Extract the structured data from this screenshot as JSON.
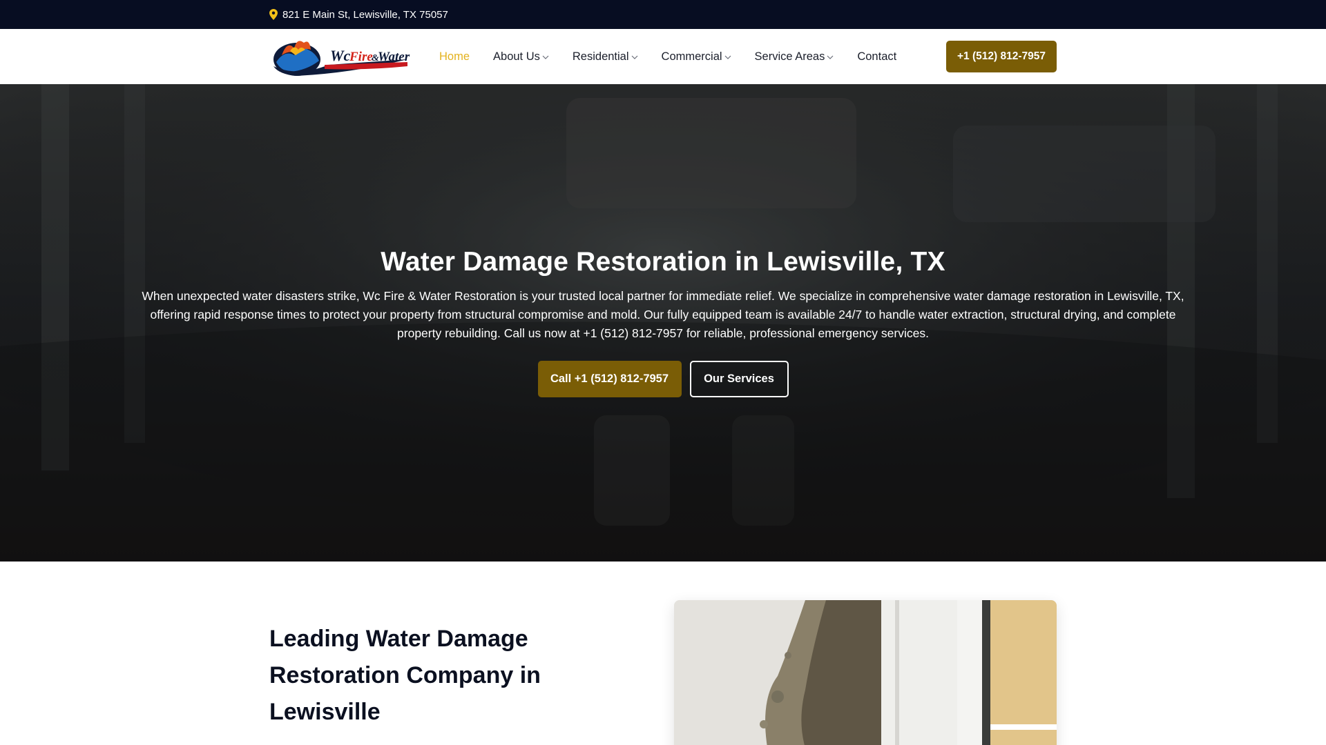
{
  "topbar": {
    "address": "821 E Main St, Lewisville, TX 75057",
    "icon": "map-pin-icon",
    "icon_color": "#f2c019"
  },
  "header": {
    "logo_text_wc": "Wc",
    "logo_text_fire": "Fire",
    "logo_text_and": "&",
    "logo_text_water": "Water",
    "nav": [
      {
        "label": "Home",
        "active": true
      },
      {
        "label": "About Us",
        "dropdown": true
      },
      {
        "label": "Residential",
        "dropdown": true
      },
      {
        "label": "Commercial",
        "dropdown": true
      },
      {
        "label": "Service Areas",
        "dropdown": true
      },
      {
        "label": "Contact"
      }
    ],
    "phone_button": "+1 (512) 812-7957"
  },
  "hero": {
    "title": "Water Damage Restoration in Lewisville, TX",
    "text": "When unexpected water disasters strike, Wc Fire & Water Restoration is your trusted local partner for immediate relief. We specialize in comprehensive water damage restoration in Lewisville, TX, offering rapid response times to protect your property from structural compromise and mold. Our fully equipped team is available 24/7 to handle water extraction, structural drying, and complete property rebuilding. Call us now at +1 (512) 812-7957 for reliable, professional emergency services.",
    "call_button": "Call +1 (512) 812-7957",
    "services_button": "Our Services"
  },
  "intro": {
    "heading": "Leading Water Damage Restoration Company in Lewisville"
  },
  "colors": {
    "topbar_bg": "#070d22",
    "accent_gold": "#7a5d06",
    "nav_active": "#e3b21e"
  }
}
